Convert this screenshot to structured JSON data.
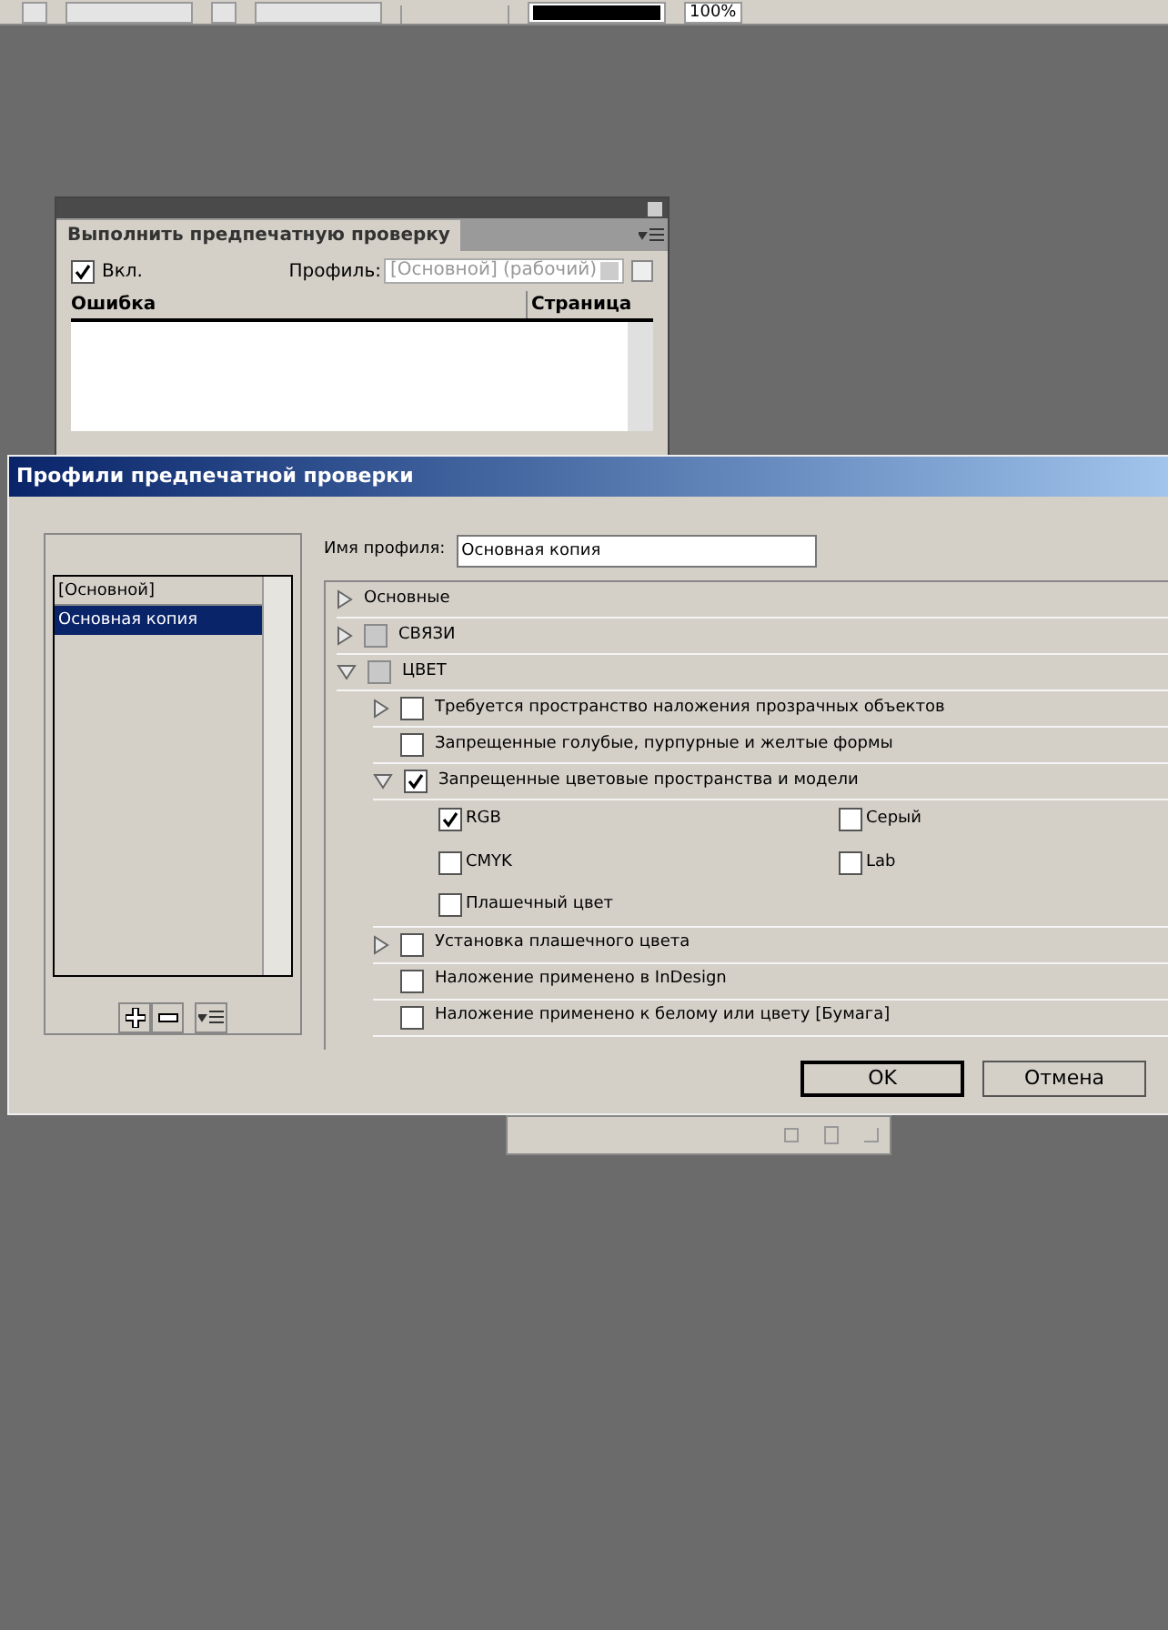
{
  "toolbar": {
    "zoom_value": "100%"
  },
  "preflight_panel": {
    "title": "Выполнить предпечатную проверку",
    "on_checkbox": {
      "label": "Вкл.",
      "checked": true
    },
    "profile_label": "Профиль:",
    "profile_value": "[Основной] (рабочий)",
    "columns": [
      "Ошибка",
      "Страница"
    ]
  },
  "dialog": {
    "title": "Профили предпечатной проверки",
    "profiles": [
      {
        "label": "[Основной]",
        "selected": false
      },
      {
        "label": "Основная копия",
        "selected": true
      }
    ],
    "profile_name_label": "Имя профиля:",
    "profile_name_value": "Основная копия",
    "tree": [
      {
        "kind": "heading",
        "label": "Основные",
        "expanded": false
      },
      {
        "kind": "group",
        "label": "СВЯЗИ",
        "expanded": false,
        "checked": false
      },
      {
        "kind": "group",
        "label": "ЦВЕТ",
        "expanded": true,
        "checked": false,
        "children": [
          {
            "kind": "rule",
            "label": "Требуется пространство наложения прозрачных объектов",
            "expandable": true,
            "expanded": false,
            "checked": false
          },
          {
            "kind": "rule",
            "label": "Запрещенные голубые, пурпурные и желтые формы",
            "expandable": false,
            "checked": false
          },
          {
            "kind": "rule",
            "label": "Запрещенные цветовые пространства и модели",
            "expandable": true,
            "expanded": true,
            "checked": true,
            "options": [
              {
                "label": "RGB",
                "checked": true
              },
              {
                "label": "Серый",
                "checked": false
              },
              {
                "label": "CMYK",
                "checked": false
              },
              {
                "label": "Lab",
                "checked": false
              },
              {
                "label": "Плашечный цвет",
                "checked": false
              }
            ]
          },
          {
            "kind": "rule",
            "label": "Установка плашечного цвета",
            "expandable": true,
            "expanded": false,
            "checked": false
          },
          {
            "kind": "rule",
            "label": "Наложение применено в InDesign",
            "expandable": false,
            "checked": false
          },
          {
            "kind": "rule",
            "label": "Наложение применено к белому или цвету [Бумага]",
            "expandable": false,
            "checked": false
          }
        ]
      }
    ],
    "buttons": [
      {
        "label": "OK",
        "kind": "default"
      },
      {
        "label": "Отмена",
        "kind": "normal"
      }
    ]
  }
}
